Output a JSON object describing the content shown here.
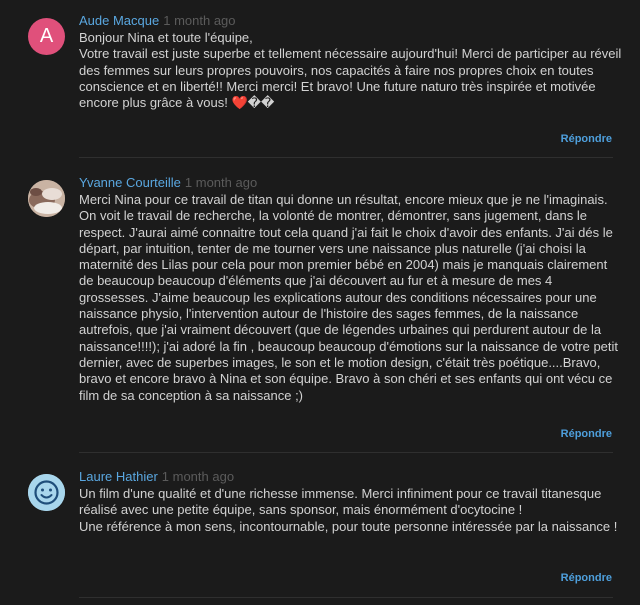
{
  "comments": [
    {
      "author": "Aude Macque",
      "time": "1 month ago",
      "avatar": {
        "type": "letter",
        "letter": "A",
        "color": "#e0507b"
      },
      "text": "Bonjour Nina et toute l'équipe,\nVotre travail est juste superbe et tellement nécessaire aujourd'hui! Merci de participer au réveil des femmes sur leurs propres pouvoirs, nos capacités à faire nos propres choix en toutes conscience et en liberté!! Merci merci! Et bravo! Une future naturo très inspirée et motivée encore plus grâce à vous! ❤️��",
      "reply_label": "Répondre"
    },
    {
      "author": "Yvanne Courteille",
      "time": "1 month ago",
      "avatar": {
        "type": "photo"
      },
      "text": "Merci Nina pour ce travail de titan qui donne un résultat, encore mieux que je ne l'imaginais. On voit le travail de recherche, la volonté de montrer, démontrer, sans jugement, dans le respect. J'aurai aimé connaitre tout cela quand j'ai fait le choix d'avoir des enfants. J'ai dés le départ, par intuition, tenter de me tourner vers une naissance plus naturelle (j'ai choisi la maternité des Lilas pour cela pour mon premier bébé en 2004) mais je manquais clairement de beaucoup beaucoup d'éléments que j'ai découvert au fur et à mesure de mes 4 grossesses. J'aime beaucoup les explications autour des conditions nécessaires pour une naissance physio, l'intervention autour de l'histoire des sages femmes, de la naissance autrefois, que j'ai vraiment découvert (que de légendes urbaines qui perdurent autour de la naissance!!!!); j'ai adoré la fin , beaucoup beaucoup d'émotions sur la naissance de votre petit dernier, avec de superbes images, le son et le motion design, c'était très poétique....Bravo, bravo et encore bravo à Nina et son équipe. Bravo à son chéri et ses enfants qui ont vécu ce film de sa conception à sa naissance ;)",
      "reply_label": "Répondre"
    },
    {
      "author": "Laure Hathier",
      "time": "1 month ago",
      "avatar": {
        "type": "smiley",
        "color": "#a8d6ec"
      },
      "text": "Un film d'une qualité et d'une richesse immense. Merci infiniment pour ce travail titanesque réalisé avec une petite équipe, sans sponsor, mais énormément d'ocytocine !\nUne référence à mon sens, incontournable, pour toute personne intéressée par la naissance !",
      "reply_label": "Répondre"
    }
  ]
}
